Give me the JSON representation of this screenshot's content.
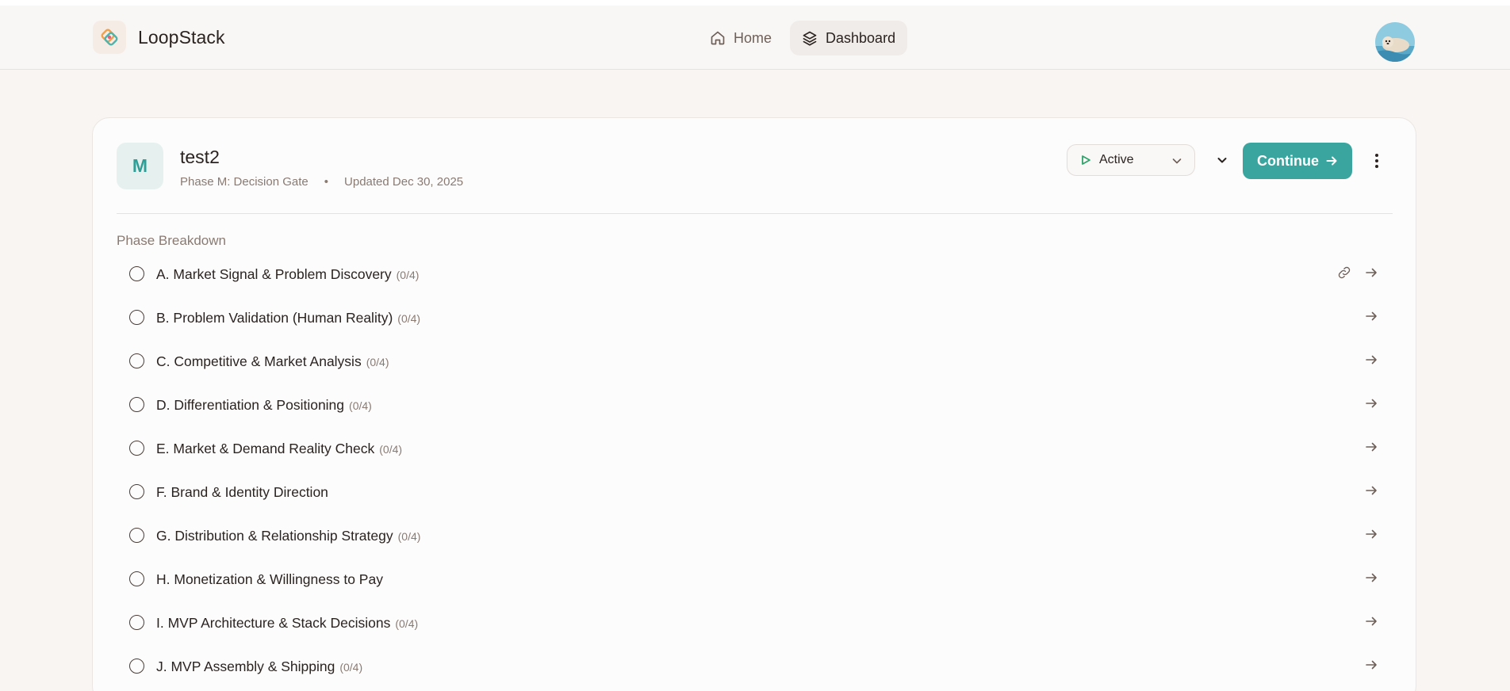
{
  "app": {
    "name": "LoopStack"
  },
  "nav": {
    "items": [
      {
        "label": "Home",
        "icon": "home-icon",
        "active": false
      },
      {
        "label": "Dashboard",
        "icon": "layers-icon",
        "active": true
      }
    ]
  },
  "project": {
    "badge": "M",
    "title": "test2",
    "phase": "Phase M: Decision Gate",
    "separator": "•",
    "updated": "Updated Dec 30, 2025",
    "status": "Active",
    "continue_label": "Continue"
  },
  "colors": {
    "accent": "#3aa59e",
    "badge_bg": "#e6f1ef",
    "page_bg": "#f8f5f3",
    "active_green": "#2fa36b"
  },
  "phase_breakdown": {
    "title": "Phase Breakdown",
    "phases": [
      {
        "label": "A. Market Signal & Problem Discovery",
        "count": "(0/4)",
        "has_link": true
      },
      {
        "label": "B. Problem Validation (Human Reality)",
        "count": "(0/4)",
        "has_link": false
      },
      {
        "label": "C. Competitive & Market Analysis",
        "count": "(0/4)",
        "has_link": false
      },
      {
        "label": "D. Differentiation & Positioning",
        "count": "(0/4)",
        "has_link": false
      },
      {
        "label": "E. Market & Demand Reality Check",
        "count": "(0/4)",
        "has_link": false
      },
      {
        "label": "F. Brand & Identity Direction",
        "count": "",
        "has_link": false
      },
      {
        "label": "G. Distribution & Relationship Strategy",
        "count": "(0/4)",
        "has_link": false
      },
      {
        "label": "H. Monetization & Willingness to Pay",
        "count": "",
        "has_link": false
      },
      {
        "label": "I. MVP Architecture & Stack Decisions",
        "count": "(0/4)",
        "has_link": false
      },
      {
        "label": "J. MVP Assembly & Shipping",
        "count": "(0/4)",
        "has_link": false
      }
    ]
  }
}
